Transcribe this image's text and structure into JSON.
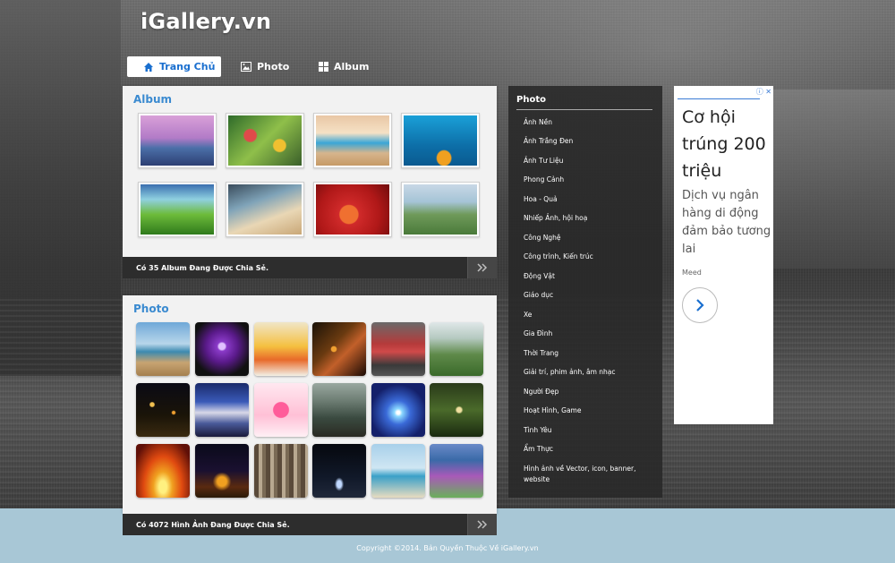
{
  "site": {
    "logo": "iGallery.vn"
  },
  "nav": {
    "tabs": [
      {
        "label": "Trang Chủ",
        "icon": "home-icon",
        "active": true
      },
      {
        "label": "Photo",
        "icon": "image-icon",
        "active": false
      },
      {
        "label": "Album",
        "icon": "grid-icon",
        "active": false
      }
    ]
  },
  "album": {
    "title": "Album",
    "footer": "Có 35 Album Đang Được Chia Sẻ.",
    "more_icon": "double-chevron-right-icon"
  },
  "photo": {
    "title": "Photo",
    "footer": "Có 4072 Hình Ảnh Đang Được Chia Sẻ.",
    "more_icon": "double-chevron-right-icon"
  },
  "categories": {
    "title": "Photo",
    "items": [
      "Ảnh Nền",
      "Ảnh Trắng Đen",
      "Ảnh Tư Liệu",
      "Phong Cảnh",
      "Hoa - Quả",
      "Nhiếp Ảnh, hội hoạ",
      "Công Nghệ",
      "Công trình, Kiến trúc",
      "Động Vật",
      "Giáo dục",
      "Xe",
      "Gia Đình",
      "Thời Trang",
      "Giải trí, phim ảnh, âm nhạc",
      "Người Đẹp",
      "Hoạt Hình, Game",
      "Tình Yêu",
      "Ẩm Thực",
      "Hình ảnh về Vector, icon, banner, website"
    ]
  },
  "ad": {
    "headline": "Cơ hội trúng 200 triệu",
    "body": "Dịch vụ ngân hàng di động đảm bảo tương lai",
    "brand": "Meed",
    "badge": "ⓘ ✕"
  },
  "footer": {
    "copyright": "Copyright ©2014. Bản Quyền Thuộc Về iGallery.vn"
  }
}
